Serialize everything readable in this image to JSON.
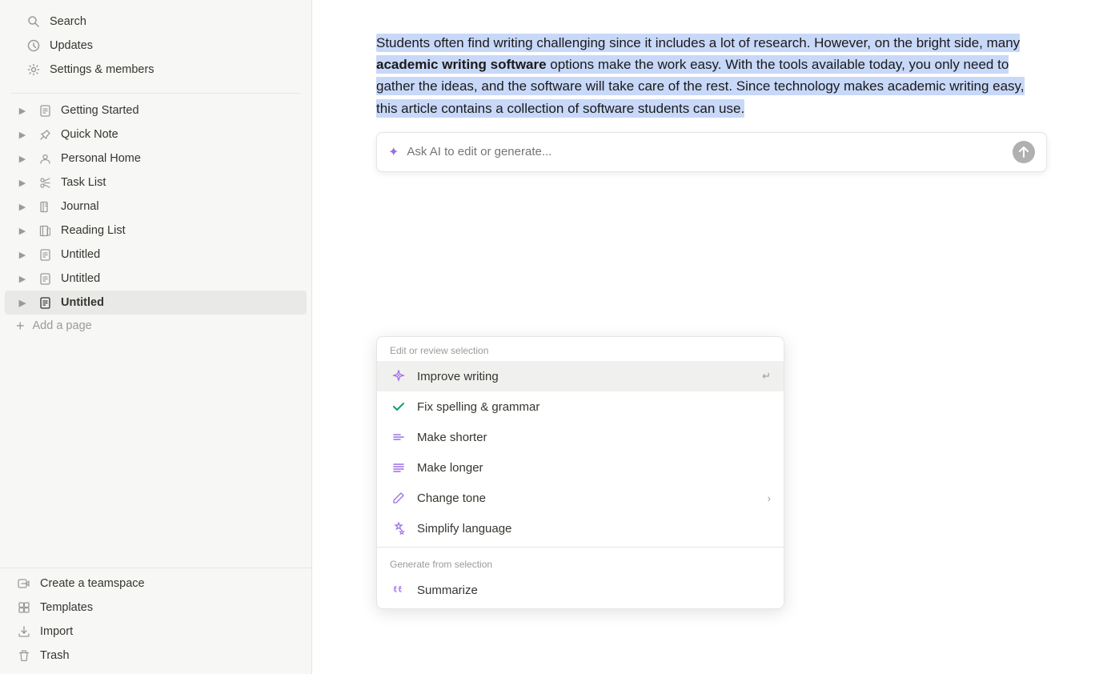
{
  "sidebar": {
    "search_label": "Search",
    "updates_label": "Updates",
    "settings_label": "Settings & members",
    "pages": [
      {
        "id": "getting-started",
        "label": "Getting Started",
        "icon": "doc",
        "hasChevron": true
      },
      {
        "id": "quick-note",
        "label": "Quick Note",
        "icon": "pin",
        "hasChevron": true
      },
      {
        "id": "personal-home",
        "label": "Personal Home",
        "icon": "person",
        "hasChevron": true
      },
      {
        "id": "task-list",
        "label": "Task List",
        "icon": "scissors",
        "hasChevron": true
      },
      {
        "id": "journal",
        "label": "Journal",
        "icon": "book",
        "hasChevron": true
      },
      {
        "id": "reading-list",
        "label": "Reading List",
        "icon": "book2",
        "hasChevron": true
      },
      {
        "id": "untitled-1",
        "label": "Untitled",
        "icon": "doc",
        "hasChevron": true
      },
      {
        "id": "untitled-2",
        "label": "Untitled",
        "icon": "doc",
        "hasChevron": true
      },
      {
        "id": "untitled-3",
        "label": "Untitled",
        "icon": "doc",
        "hasChevron": true,
        "active": true
      }
    ],
    "add_page_label": "Add a page",
    "create_teamspace_label": "Create a teamspace",
    "templates_label": "Templates",
    "import_label": "Import",
    "trash_label": "Trash"
  },
  "content": {
    "selected_text": "Students often find writing challenging since it includes a lot of research. However, on the bright side, many ",
    "bold_text": "academic writing software",
    "selected_text_after": " options make the work easy. With the tools available today, you only need to gather the ideas, and the software will take care of the rest. Since technology makes academic writing easy, this article contains a collection of software students can use."
  },
  "ai_input": {
    "placeholder": "Ask AI to edit or generate..."
  },
  "dropdown": {
    "edit_section_header": "Edit or review selection",
    "items": [
      {
        "id": "improve-writing",
        "label": "Improve writing",
        "icon": "sparkle",
        "shortcut": "↵",
        "highlighted": true
      },
      {
        "id": "fix-spelling",
        "label": "Fix spelling & grammar",
        "icon": "check",
        "shortcut": ""
      },
      {
        "id": "make-shorter",
        "label": "Make shorter",
        "icon": "lines-short",
        "shortcut": ""
      },
      {
        "id": "make-longer",
        "label": "Make longer",
        "icon": "lines-long",
        "shortcut": ""
      },
      {
        "id": "change-tone",
        "label": "Change tone",
        "icon": "pencil",
        "shortcut": "",
        "hasArrow": true
      },
      {
        "id": "simplify-language",
        "label": "Simplify language",
        "icon": "sparkle2",
        "shortcut": ""
      }
    ],
    "generate_section_header": "Generate from selection",
    "generate_items": [
      {
        "id": "summarize",
        "label": "Summarize",
        "icon": "quotes",
        "shortcut": ""
      }
    ]
  }
}
